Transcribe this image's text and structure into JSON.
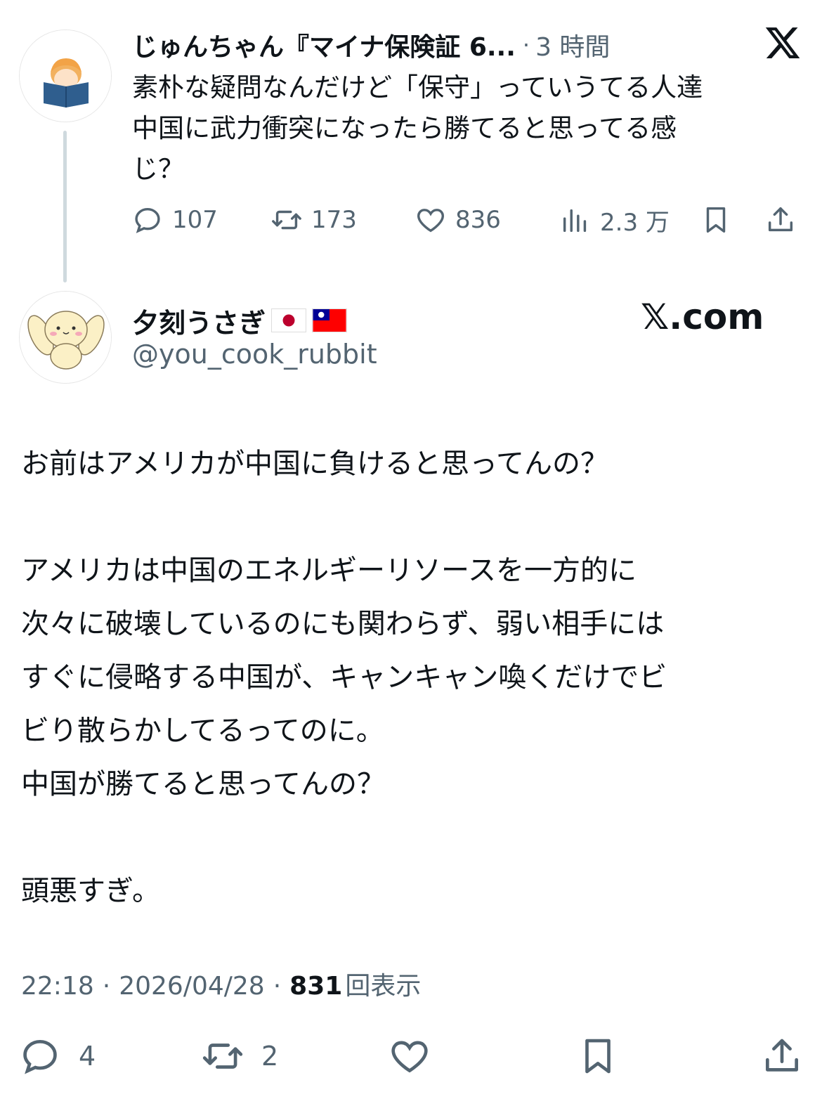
{
  "parent_tweet": {
    "author_name": "じゅんちゃん『マイナ保険証 6...",
    "separator": "·",
    "time": "3 時間",
    "text_lines": [
      "素朴な疑問なんだけど「保守」っていうてる人達",
      "中国に武力衝突になったら勝てると思ってる感",
      "じ？"
    ],
    "stats": {
      "replies": "107",
      "retweets": "173",
      "likes": "836",
      "views": "2.3 万"
    },
    "icons": [
      "reply-icon",
      "retweet-icon",
      "like-icon",
      "views-icon",
      "bookmark-icon",
      "share-icon"
    ]
  },
  "x_logo": "x-logo-icon",
  "main_tweet": {
    "author_name": "夕刻うさぎ",
    "flags": [
      "japan-flag-icon",
      "taiwan-flag-icon"
    ],
    "handle": "@you_cook_rubbit",
    "site_label": "𝕏.com",
    "text_lines": [
      "お前はアメリカが中国に負けると思ってんの？",
      "",
      "アメリカは中国のエネルギーリソースを一方的に",
      "次々に破壊しているのにも関わらず、弱い相手には",
      "すぐに侵略する中国が、キャンキャン喚くだけでビ",
      "ビり散らかしてるってのに。",
      "中国が勝てると思ってんの？",
      "",
      "頭悪すぎ。"
    ],
    "meta": {
      "time": "22:18",
      "date": "2026/04/28",
      "views_count": "831",
      "views_label": "回表示",
      "separator": "·"
    },
    "actions": {
      "replies": "4",
      "retweets": "2"
    }
  },
  "colors": {
    "text": "#0f1419",
    "secondary": "#536471",
    "thread_line": "#cfd9de"
  }
}
